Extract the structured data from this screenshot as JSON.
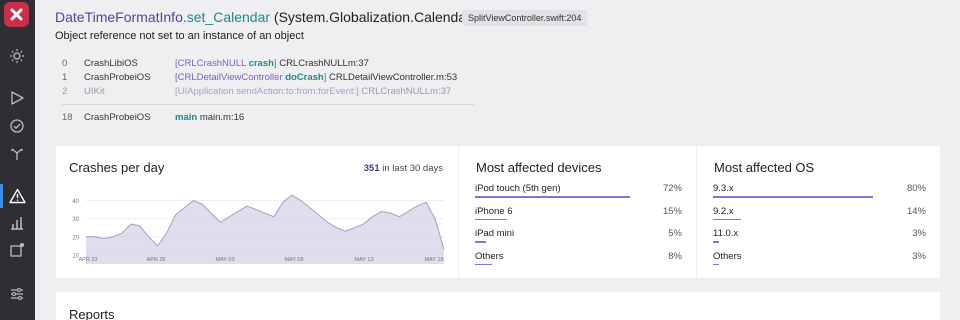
{
  "sidebar": {
    "items": [
      {
        "icon": "sun-icon"
      },
      {
        "icon": "play-icon"
      },
      {
        "icon": "check-circle-icon"
      },
      {
        "icon": "fork-icon"
      },
      {
        "icon": "warning-icon",
        "active": true
      },
      {
        "icon": "bar-chart-icon"
      },
      {
        "icon": "notification-square-icon"
      },
      {
        "icon": "sliders-icon"
      }
    ]
  },
  "header": {
    "class_name": "DateTimeFormatInfo.",
    "method_name": "set_Calendar",
    "signature": " (System.Globalization.Calendar value)",
    "file_badge": "SplitViewController.swift:204",
    "message": "Object reference not set to an instance of an object"
  },
  "stack": [
    {
      "index": "0",
      "library": "CrashLibiOS",
      "open": "[",
      "cls": "CRLCrashNULL",
      "method": "crash",
      "close": "]",
      "location": " CRLCrashNULLm:37",
      "dim": false
    },
    {
      "index": "1",
      "library": "CrashProbeiOS",
      "open": "[",
      "cls": "CRLDetailViewController",
      "method": "doCrash",
      "close": "]",
      "location": " CRLDetailViewController.m:53",
      "dim": false
    },
    {
      "index": "2",
      "library": "UIKit",
      "open": "[",
      "cls": "UIApplication",
      "method": "sendAction:to:from:forEvent:",
      "close": "]",
      "location": " CRLCrashNULLm:37",
      "dim": true
    }
  ],
  "main_frame": {
    "index": "18",
    "library": "CrashProbeiOS",
    "method": "main",
    "location": "main.m:16"
  },
  "crashes": {
    "title": "Crashes per day",
    "count": "351",
    "count_suffix": " in last 30 days"
  },
  "chart_data": {
    "type": "area",
    "title": "Crashes per day",
    "x": [
      "Apr 21",
      "Apr 22",
      "Apr 23",
      "Apr 24",
      "Apr 25",
      "Apr 26",
      "Apr 27",
      "Apr 28",
      "Apr 29",
      "Apr 30",
      "May 01",
      "May 02",
      "May 03",
      "May 04",
      "May 05",
      "May 06",
      "May 07",
      "May 08",
      "May 09",
      "May 10",
      "May 11",
      "May 12",
      "May 13",
      "May 14",
      "May 15",
      "May 16",
      "May 17",
      "May 18",
      "May 19"
    ],
    "values": [
      20,
      20,
      19,
      20,
      22,
      27,
      26,
      20,
      15,
      22,
      32,
      36,
      40,
      38,
      33,
      28,
      31,
      34,
      37,
      35,
      33,
      31,
      39,
      43,
      40,
      36,
      32,
      28,
      25,
      23,
      25,
      27,
      31,
      34,
      33,
      31,
      34,
      37,
      39,
      30,
      13
    ],
    "xtick_labels": [
      "APR 23",
      "APR 28",
      "MAY 03",
      "MAY 08",
      "MAY 13",
      "MAY 18"
    ],
    "ytick_labels": [
      "10",
      "20",
      "30",
      "40"
    ],
    "ylim": [
      5,
      48
    ],
    "grid": true,
    "color": "#d5d2e6",
    "line_color": "#a9a6c6"
  },
  "devices": {
    "title": "Most affected devices",
    "items": [
      {
        "name": "iPod touch (5th gen)",
        "pct": "72%",
        "value": 72
      },
      {
        "name": "iPhone 6",
        "pct": "15%",
        "value": 15
      },
      {
        "name": "iPad mini",
        "pct": "5%",
        "value": 5
      },
      {
        "name": "Others",
        "pct": "8%",
        "value": 8
      }
    ]
  },
  "os": {
    "title": "Most affected OS",
    "items": [
      {
        "name": "9.3.x",
        "pct": "80%",
        "value": 80
      },
      {
        "name": "9.2.x",
        "pct": "14%",
        "value": 14
      },
      {
        "name": "11.0.x",
        "pct": "3%",
        "value": 3
      },
      {
        "name": "Others",
        "pct": "3%",
        "value": 3
      }
    ]
  },
  "reports": {
    "title": "Reports"
  },
  "colors": {
    "accent": "#3a8ee6",
    "brand": "#c8304a",
    "bar": "#8c6fd1",
    "class": "#5b3fa3",
    "method": "#1e8a8a"
  }
}
